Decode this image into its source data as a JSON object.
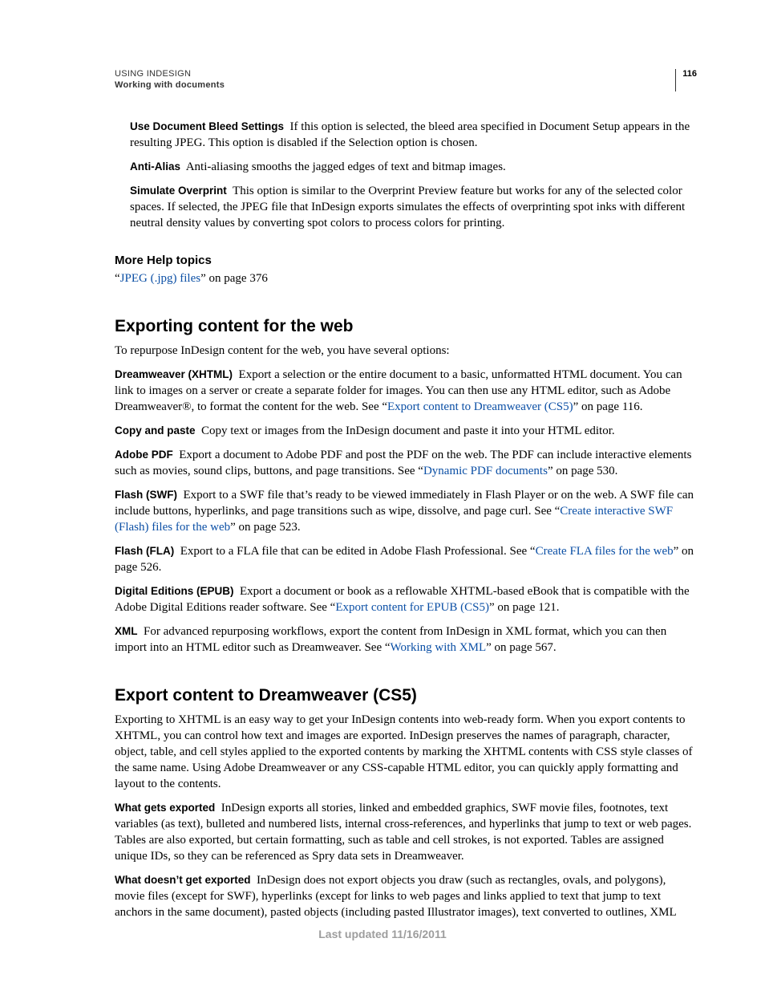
{
  "header": {
    "doc_title": "USING INDESIGN",
    "section": "Working with documents",
    "page_number": "116"
  },
  "top_terms": [
    {
      "term": "Use Document Bleed Settings",
      "text": "If this option is selected, the bleed area specified in Document Setup appears in the resulting JPEG. This option is disabled if the Selection option is chosen."
    },
    {
      "term": "Anti-Alias",
      "text": "Anti-aliasing smooths the jagged edges of text and bitmap images."
    },
    {
      "term": "Simulate Overprint",
      "text": "This option is similar to the Overprint Preview feature but works for any of the selected color spaces. If selected, the JPEG file that InDesign exports simulates the effects of overprinting spot inks with different neutral density values by converting spot colors to process colors for printing."
    }
  ],
  "more_help": {
    "heading": "More Help topics",
    "q1": "“",
    "link": "JPEG (.jpg) files",
    "tail": "” on page 376"
  },
  "sec1": {
    "heading": "Exporting content for the web",
    "intro": "To repurpose InDesign content for the web, you have several options:"
  },
  "dreamweaver": {
    "term": "Dreamweaver (XHTML)",
    "pre": "Export a selection or the entire document to a basic, unformatted HTML document. You can link to images on a server or create a separate folder for images. You can then use any HTML editor, such as Adobe Dreamweaver®, to format the content for the web. See “",
    "link": "Export content to Dreamweaver (CS5)",
    "tail": "” on page 116."
  },
  "copypaste": {
    "term": "Copy and paste",
    "text": "Copy text or images from the InDesign document and paste it into your HTML editor."
  },
  "pdf": {
    "term": "Adobe PDF",
    "pre": "Export a document to Adobe PDF and post the PDF on the web. The PDF can include interactive elements such as movies, sound clips, buttons, and page transitions. See “",
    "link": "Dynamic PDF documents",
    "tail": "” on page 530."
  },
  "swf": {
    "term": "Flash (SWF)",
    "pre": "Export to a SWF file that’s ready to be viewed immediately in Flash Player or on the web. A SWF file can include buttons, hyperlinks, and page transitions such as wipe, dissolve, and page curl. See “",
    "link": "Create interactive SWF (Flash) files for the web",
    "tail": "” on page 523."
  },
  "fla": {
    "term": "Flash (FLA)",
    "pre": "Export to a FLA file that can be edited in Adobe Flash Professional. See “",
    "link": "Create FLA files for the web",
    "tail": "” on page 526."
  },
  "epub": {
    "term": "Digital Editions (EPUB)",
    "pre": "Export a document or book as a reflowable XHTML-based eBook that is compatible with the Adobe Digital Editions reader software. See “",
    "link": "Export content for EPUB (CS5)",
    "tail": "” on page 121."
  },
  "xml": {
    "term": "XML",
    "pre": "For advanced repurposing workflows, export the content from InDesign in XML format, which you can then import into an HTML editor such as Dreamweaver. See “",
    "link": "Working with XML",
    "tail": "” on page 567."
  },
  "sec2": {
    "heading": "Export content to Dreamweaver (CS5)",
    "intro": "Exporting to XHTML is an easy way to get your InDesign contents into web-ready form. When you export contents to XHTML, you can control how text and images are exported. InDesign preserves the names of paragraph, character, object, table, and cell styles applied to the exported contents by marking the XHTML contents with CSS style classes of the same name. Using Adobe Dreamweaver or any CSS-capable HTML editor, you can quickly apply formatting and layout to the contents."
  },
  "exported": {
    "term": "What gets exported",
    "text": "InDesign exports all stories, linked and embedded graphics, SWF movie files, footnotes, text variables (as text), bulleted and numbered lists, internal cross-references, and hyperlinks that jump to text or web pages. Tables are also exported, but certain formatting, such as table and cell strokes, is not exported. Tables are assigned unique IDs, so they can be referenced as Spry data sets in Dreamweaver."
  },
  "not_exported": {
    "term": "What doesn’t get exported",
    "text": "InDesign does not export objects you draw (such as rectangles, ovals, and polygons), movie files (except for SWF), hyperlinks (except for links to web pages and links applied to text that jump to text anchors in the same document), pasted objects (including pasted Illustrator images), text converted to outlines, XML"
  },
  "footer": "Last updated 11/16/2011"
}
